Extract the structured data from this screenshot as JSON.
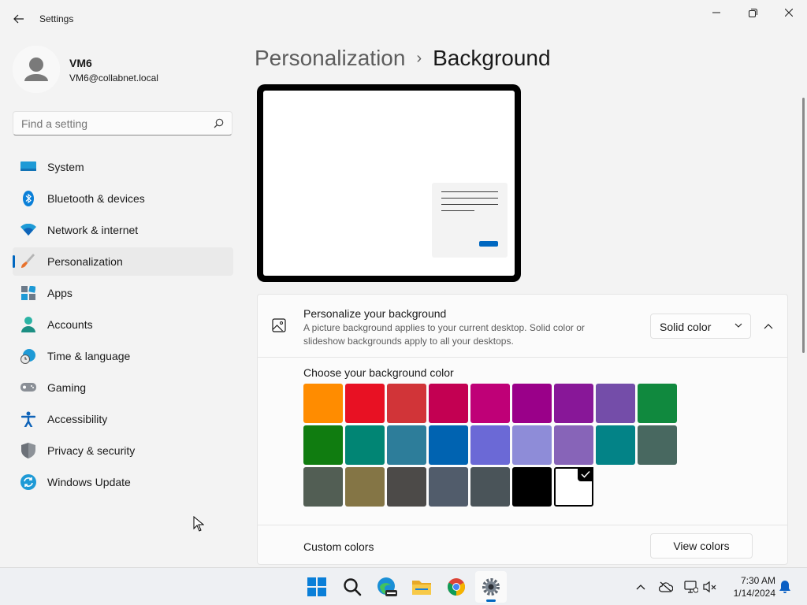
{
  "window": {
    "title": "Settings"
  },
  "user": {
    "name": "VM6",
    "email": "VM6@collabnet.local"
  },
  "search": {
    "placeholder": "Find a setting"
  },
  "nav": [
    {
      "label": "System",
      "icon": "system-icon"
    },
    {
      "label": "Bluetooth & devices",
      "icon": "bluetooth-icon"
    },
    {
      "label": "Network & internet",
      "icon": "wifi-icon"
    },
    {
      "label": "Personalization",
      "icon": "paintbrush-icon",
      "selected": true
    },
    {
      "label": "Apps",
      "icon": "apps-icon"
    },
    {
      "label": "Accounts",
      "icon": "accounts-icon"
    },
    {
      "label": "Time & language",
      "icon": "clock-globe-icon"
    },
    {
      "label": "Gaming",
      "icon": "gamepad-icon"
    },
    {
      "label": "Accessibility",
      "icon": "accessibility-icon"
    },
    {
      "label": "Privacy & security",
      "icon": "shield-icon"
    },
    {
      "label": "Windows Update",
      "icon": "update-icon"
    }
  ],
  "breadcrumb": {
    "parent": "Personalization",
    "separator": "›",
    "current": "Background"
  },
  "background_card": {
    "title": "Personalize your background",
    "description": "A picture background applies to your current desktop. Solid color or slideshow backgrounds apply to all your desktops.",
    "dropdown_value": "Solid color",
    "choose_label": "Choose your background color",
    "colors": [
      [
        "#ff8c00",
        "#e81123",
        "#d13438",
        "#c30052",
        "#bf0077",
        "#9a0089",
        "#881798",
        "#744da9",
        "#10893e"
      ],
      [
        "#107c10",
        "#018574",
        "#2d7d9a",
        "#0063b1",
        "#6b69d6",
        "#8e8cd8",
        "#8764b8",
        "#038387",
        "#486860"
      ],
      [
        "#525e54",
        "#847545",
        "#4c4a48",
        "#515c6b",
        "#4a5459",
        "#000000",
        "#ffffff"
      ]
    ],
    "selected_color": "#ffffff",
    "custom_label": "Custom colors",
    "view_colors_label": "View colors"
  },
  "taskbar": {
    "apps": [
      "windows-start-icon",
      "search-icon",
      "edge-preview-icon",
      "file-explorer-icon",
      "chrome-icon",
      "settings-icon"
    ],
    "active_app": "settings-icon",
    "time": "7:30 AM",
    "date": "1/14/2024"
  }
}
